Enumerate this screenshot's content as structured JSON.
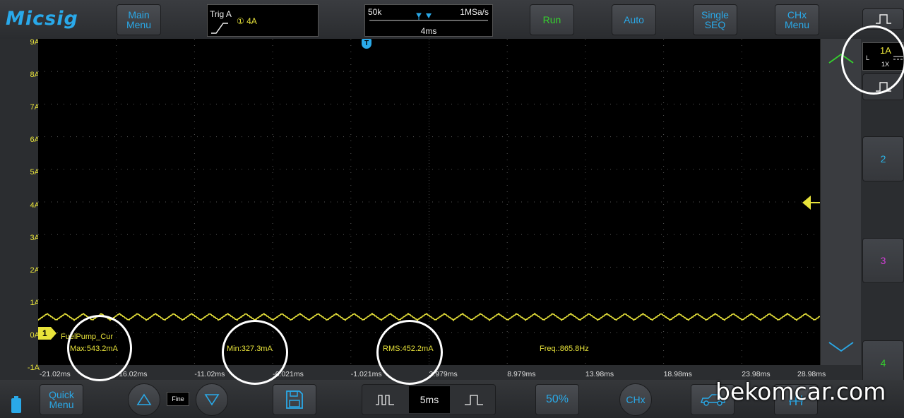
{
  "brand": "Micsig",
  "top": {
    "main_menu": [
      "Main",
      "Menu"
    ],
    "trigger": {
      "label": "Trig  A",
      "channel_level": "① 4A"
    },
    "timebase": {
      "memory": "50k",
      "sample_rate": "1MSa/s",
      "scale": "4ms"
    },
    "run": "Run",
    "auto": "Auto",
    "single": [
      "Single",
      "SEQ"
    ],
    "chx": [
      "CHx",
      "Menu"
    ]
  },
  "y_axis_labels": [
    "9A",
    "8A",
    "7A",
    "6A",
    "5A",
    "4A",
    "3A",
    "2A",
    "1A",
    "0A",
    "-1A"
  ],
  "x_axis_labels": [
    "-21.02ms",
    "-16.02ms",
    "-11.02ms",
    "-6.021ms",
    "-1.021ms",
    "3.979ms",
    "8.979ms",
    "13.98ms",
    "18.98ms",
    "23.98ms",
    "28.98ms"
  ],
  "trigger_marker": "T",
  "channel": {
    "number": "1",
    "name": "FuelPump_Cur"
  },
  "measurements": {
    "max": "Max:543.2mA",
    "min": "Min:327.3mA",
    "rms": "RMS:452.2mA",
    "freq": "Freq.:865.8Hz"
  },
  "ch1_settings": {
    "scale": "1A",
    "coupling": "L",
    "probe": "1X"
  },
  "channels": [
    "2",
    "3",
    "4"
  ],
  "bottom": {
    "quick_menu": [
      "Quick",
      "Menu"
    ],
    "fine": "Fine",
    "timebase": "5ms",
    "fifty": "50%",
    "chx": "CHx"
  },
  "watermark": "bekomcar.com",
  "colors": {
    "ch1": "#e8e33a",
    "ch2": "#2ab5e8",
    "ch3": "#d23ed6",
    "ch4": "#35d12e",
    "accent": "#2aa9e8"
  }
}
